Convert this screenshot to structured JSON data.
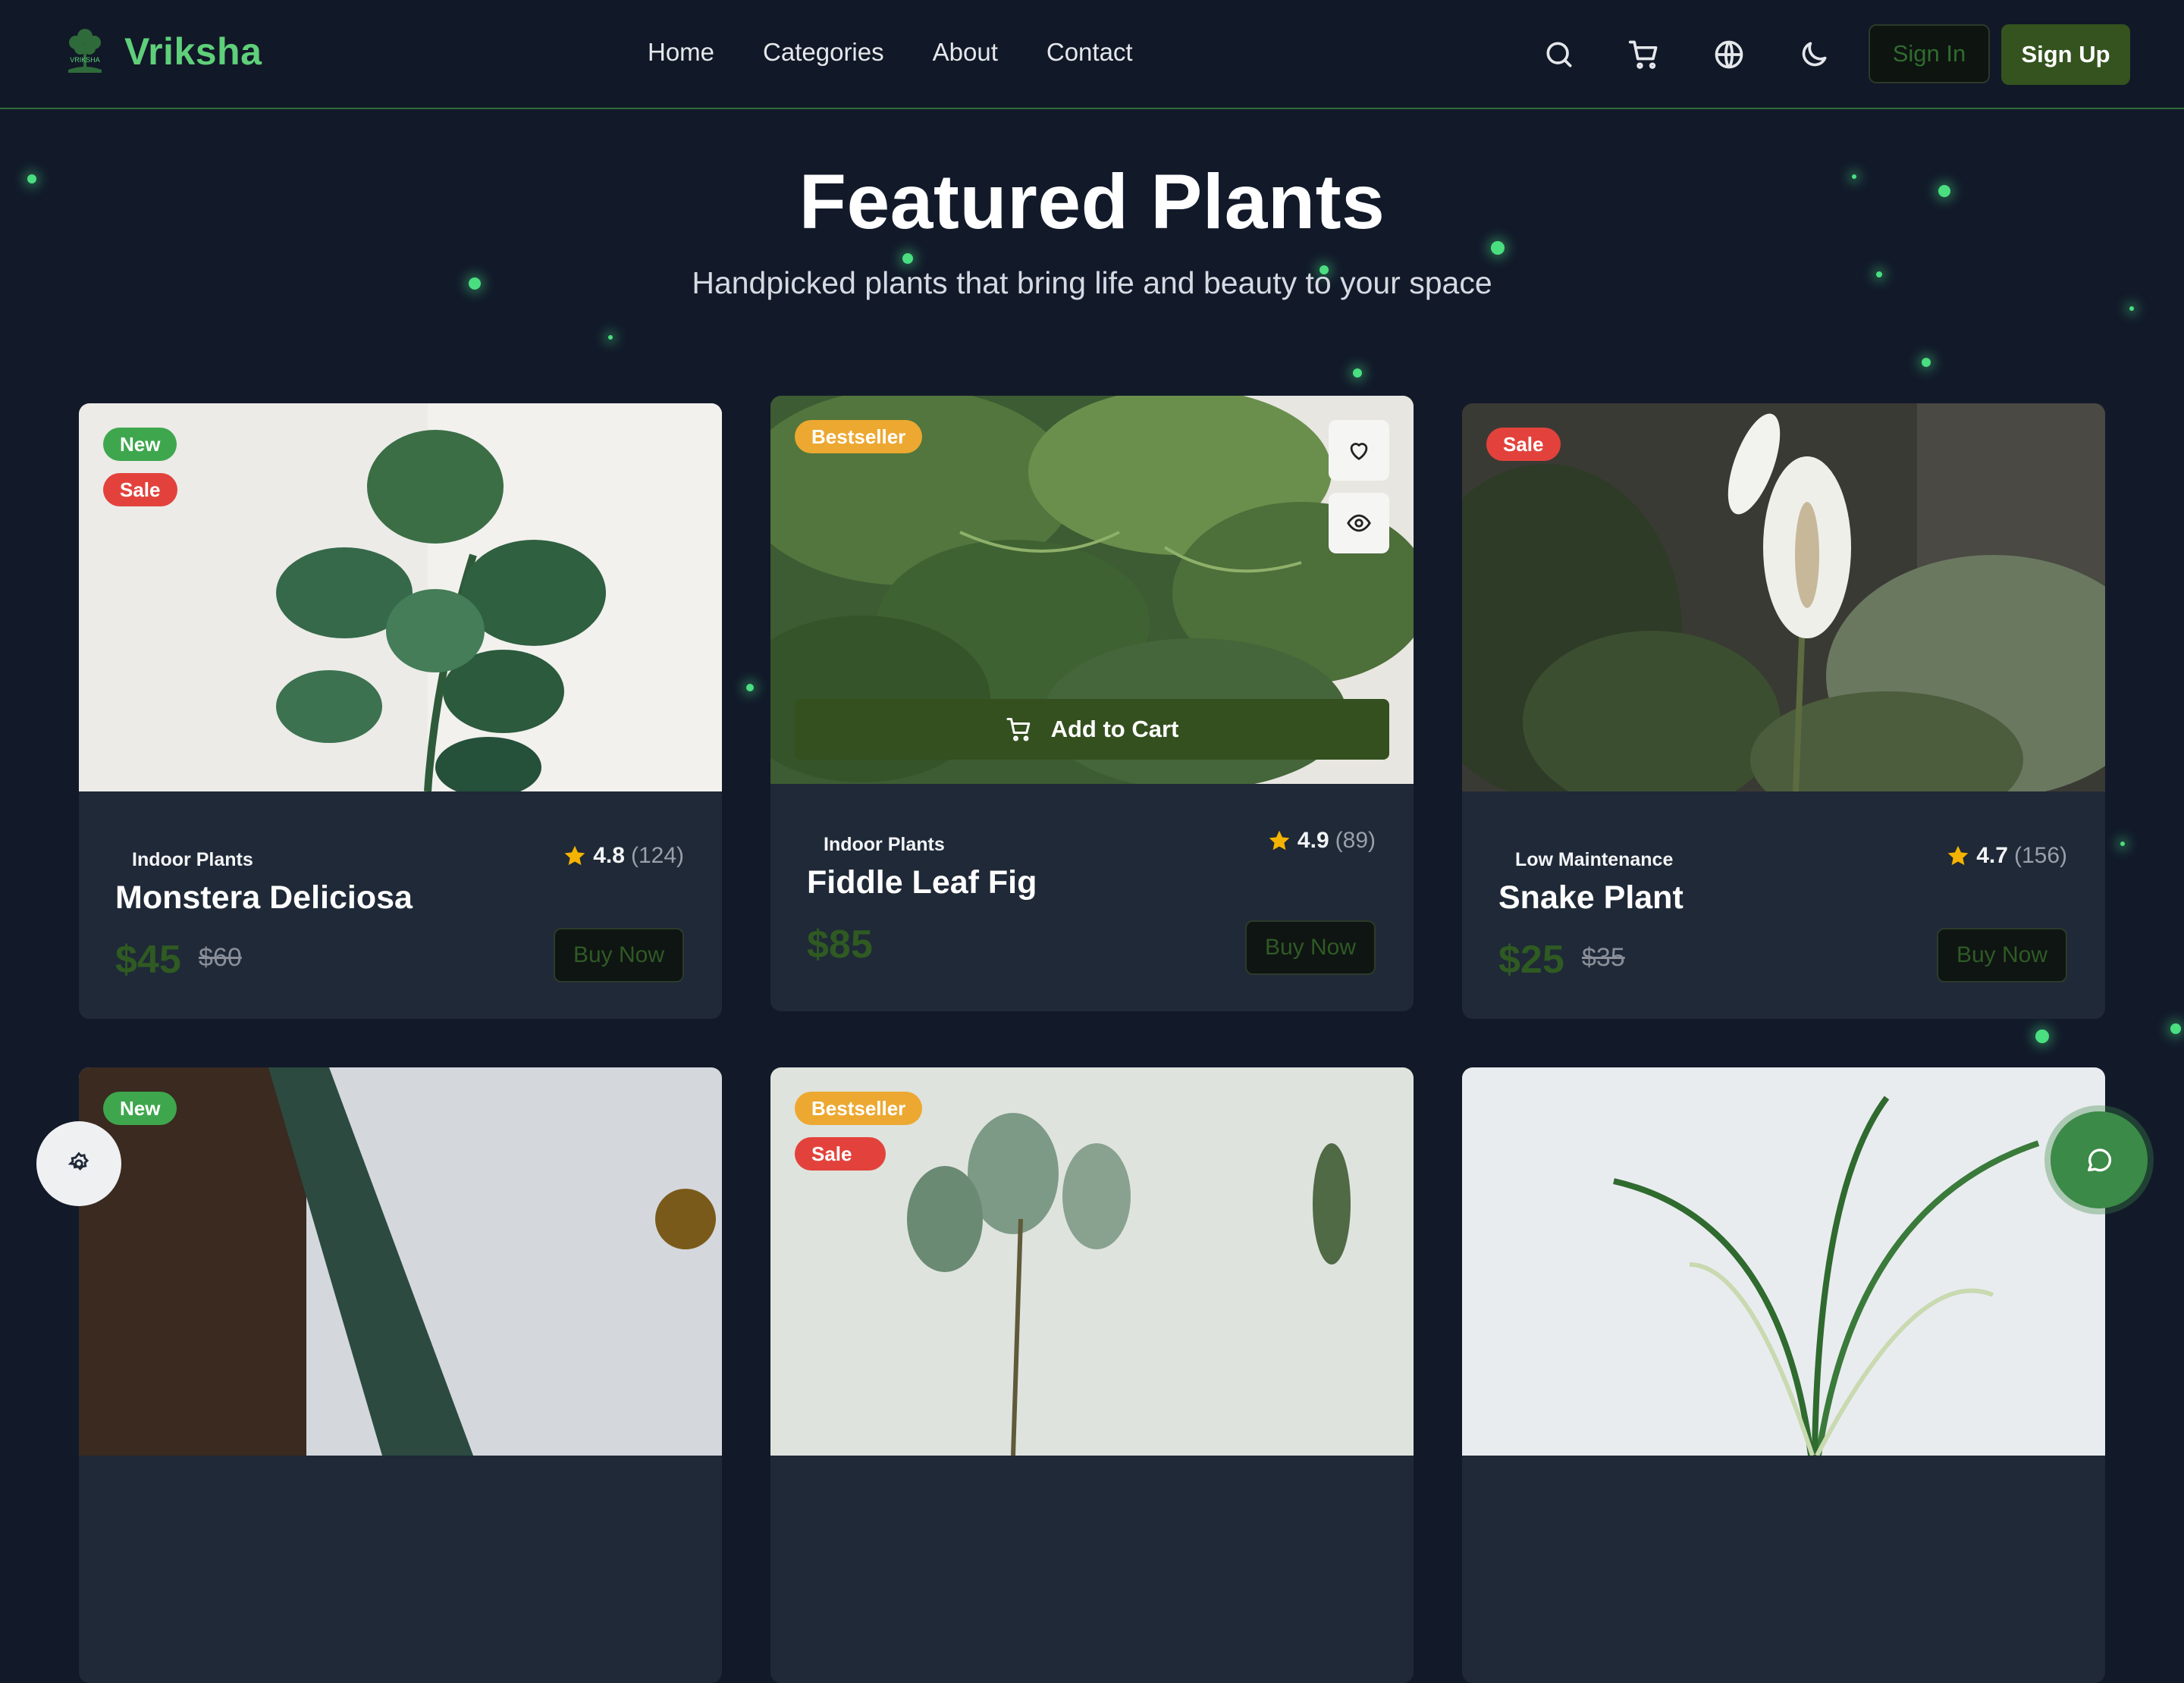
{
  "header": {
    "brand": "Vriksha",
    "logo_text": "VRIKSHA",
    "nav": [
      "Home",
      "Categories",
      "About",
      "Contact"
    ],
    "icons": [
      "search-icon",
      "cart-icon",
      "globe-icon",
      "moon-icon"
    ],
    "sign_in": "Sign In",
    "sign_up": "Sign Up"
  },
  "hero": {
    "title": "Featured Plants",
    "subtitle": "Handpicked plants that bring life and beauty to your space"
  },
  "products": [
    {
      "name": "Monstera Deliciosa",
      "category": "Indoor Plants",
      "rating": "4.8",
      "reviews": "(124)",
      "price": "$45",
      "old_price": "$60",
      "badges": [
        "New",
        "Sale"
      ],
      "buy": "Buy Now"
    },
    {
      "name": "Fiddle Leaf Fig",
      "category": "Indoor Plants",
      "rating": "4.9",
      "reviews": "(89)",
      "price": "$85",
      "old_price": "",
      "badges": [
        "Bestseller"
      ],
      "buy": "Buy Now",
      "add_to_cart": "Add to Cart"
    },
    {
      "name": "Snake Plant",
      "category": "Low Maintenance",
      "rating": "4.7",
      "reviews": "(156)",
      "price": "$25",
      "old_price": "$35",
      "badges": [
        "Sale"
      ],
      "buy": "Buy Now"
    }
  ],
  "second_row": [
    {
      "badges": [
        "New"
      ]
    },
    {
      "badges": [
        "Bestseller",
        "Sale"
      ]
    },
    {
      "badges": []
    }
  ],
  "colors": {
    "background": "#121a2a",
    "card": "#1f2937",
    "accent_green": "#5fcf7a",
    "button_green": "#34531f",
    "badge_new": "#3ea74e",
    "badge_sale": "#e3423c",
    "badge_bestseller": "#eca830",
    "star": "#f5b301"
  }
}
